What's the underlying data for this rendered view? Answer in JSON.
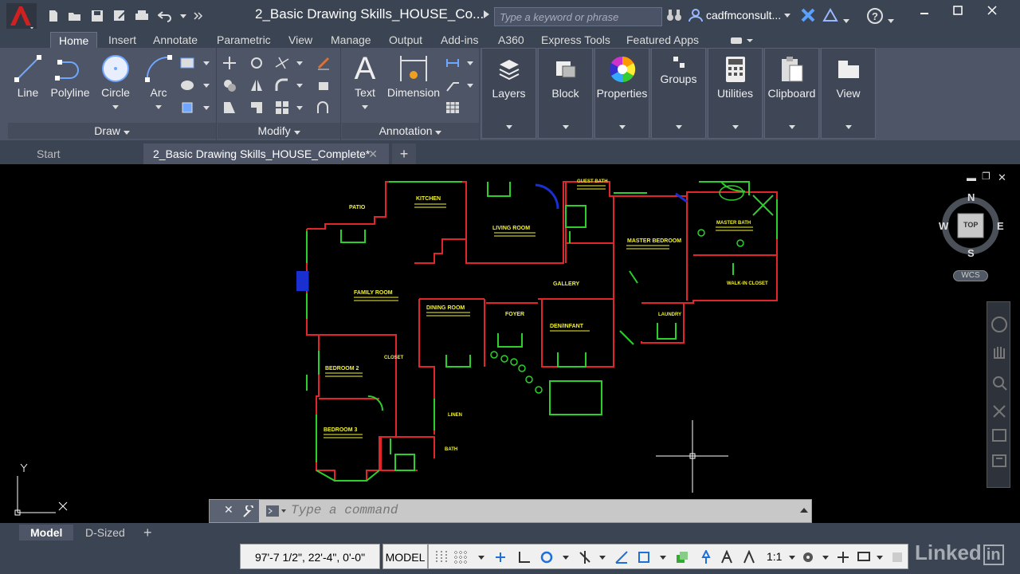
{
  "window": {
    "doc_title": "2_Basic Drawing Skills_HOUSE_Co...",
    "search_placeholder": "Type a keyword or phrase",
    "user": "cadfmconsult..."
  },
  "ribbon_tabs": [
    {
      "label": "Home",
      "active": true
    },
    {
      "label": "Insert"
    },
    {
      "label": "Annotate"
    },
    {
      "label": "Parametric"
    },
    {
      "label": "View"
    },
    {
      "label": "Manage"
    },
    {
      "label": "Output"
    },
    {
      "label": "Add-ins"
    },
    {
      "label": "A360"
    },
    {
      "label": "Express Tools"
    },
    {
      "label": "Featured Apps"
    }
  ],
  "ribbon": {
    "draw": {
      "line": "Line",
      "polyline": "Polyline",
      "circle": "Circle",
      "arc": "Arc",
      "footer": "Draw"
    },
    "modify": {
      "footer": "Modify"
    },
    "annotation": {
      "text": "Text",
      "dimension": "Dimension",
      "footer": "Annotation"
    },
    "layers": "Layers",
    "block": "Block",
    "properties": "Properties",
    "groups": "Groups",
    "utilities": "Utilities",
    "clipboard": "Clipboard",
    "view": "View"
  },
  "file_tabs": {
    "start": "Start",
    "active": "2_Basic Drawing Skills_HOUSE_Complete*"
  },
  "drawing": {
    "rooms": [
      "PATIO",
      "KITCHEN",
      "LIVING ROOM",
      "GUEST BATH",
      "MASTER BEDROOM",
      "MASTER BATH",
      "WALK-IN CLOSET",
      "FAMILY ROOM",
      "DINING ROOM",
      "FOYER",
      "DEN/INFANT",
      "GALLERY",
      "LAUNDRY",
      "BEDROOM 2",
      "BEDROOM 3",
      "CLOSET",
      "LINEN",
      "BATH"
    ]
  },
  "viewcube": {
    "n": "N",
    "s": "S",
    "e": "E",
    "w": "W",
    "face": "TOP",
    "wcs": "WCS"
  },
  "command": {
    "placeholder": "Type a command"
  },
  "layout_tabs": [
    "Model",
    "D-Sized"
  ],
  "status": {
    "coords": "97'-7 1/2\", 22'-4\", 0'-0\"",
    "space": "MODEL",
    "scale": "1:1"
  },
  "colors": {
    "wall": "#e0262a",
    "door": "#2bd02b",
    "text": "#f3f330",
    "blue": "#1a2fd0"
  }
}
